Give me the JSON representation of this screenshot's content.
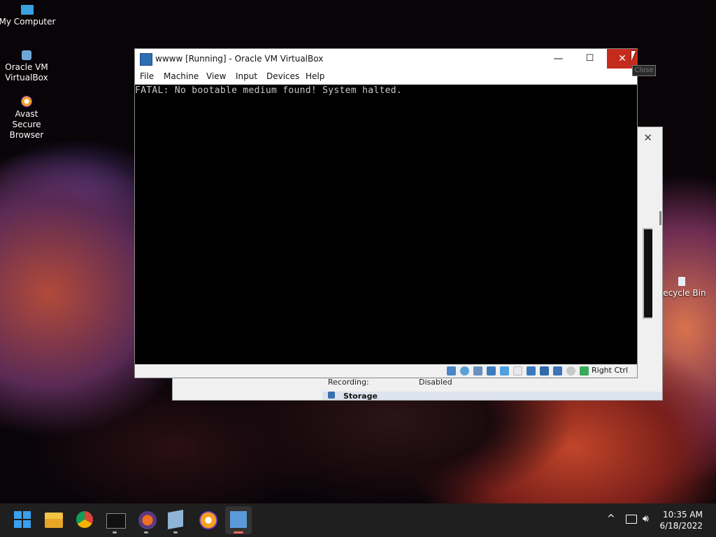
{
  "desktop": {
    "icons": [
      {
        "label": "My Computer"
      },
      {
        "label": "Oracle VM VirtualBox"
      },
      {
        "label": "Avast Secure Browser"
      },
      {
        "label": "Recycle Bin"
      }
    ]
  },
  "background_window": {
    "recording_label": "Recording:",
    "recording_value": "Disabled",
    "storage_label": "Storage"
  },
  "vm_window": {
    "title": "wwww [Running] - Oracle VM VirtualBox",
    "controls": {
      "minimize": "—",
      "maximize": "☐",
      "close": "✕"
    },
    "menu": [
      "File",
      "Machine",
      "View",
      "Input",
      "Devices",
      "Help"
    ],
    "console_text": "FATAL: No bootable medium found! System halted.",
    "status_icons": [
      "hard-disk",
      "optical-drive",
      "audio",
      "network",
      "usb",
      "shared-folders",
      "display",
      "recording",
      "cpu",
      "mouse-integration",
      "keyboard-capture"
    ],
    "host_key": "Right Ctrl"
  },
  "tooltip": {
    "text": "Close"
  },
  "taskbar": {
    "apps": [
      "start",
      "file-explorer",
      "chrome",
      "terminal",
      "avast-cleanup",
      "virtualbox",
      "avast-secure-browser",
      "virtualbox-vm"
    ],
    "time": "10:35 AM",
    "date": "6/18/2022"
  },
  "colors": {
    "close_button": "#c42b1c",
    "taskbar": "#1f1f1f",
    "console_bg": "#000000"
  }
}
